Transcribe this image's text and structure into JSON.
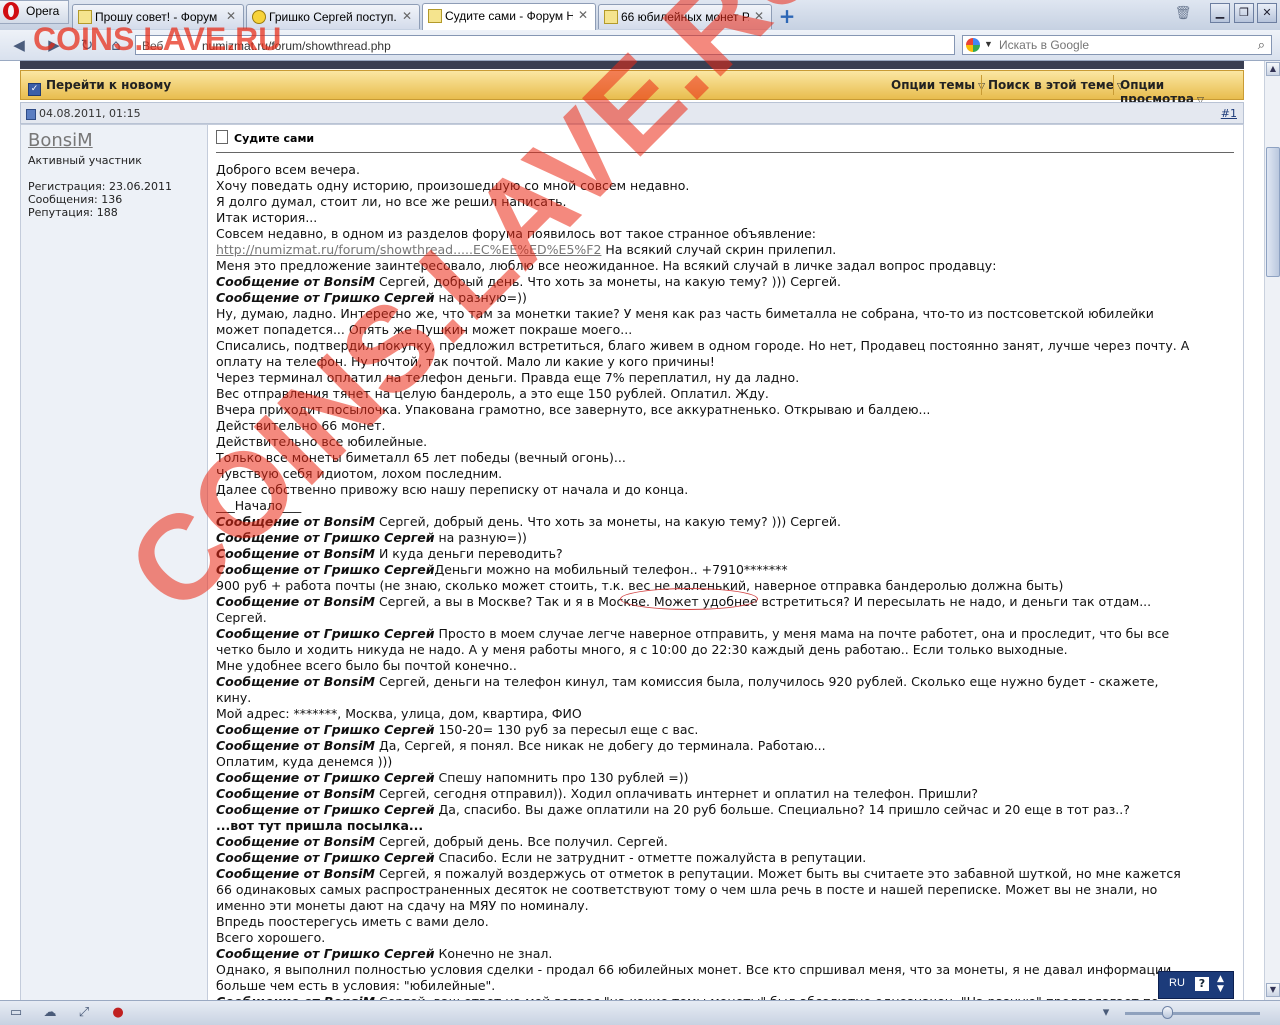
{
  "browser": {
    "app_name": "Opera",
    "tabs": [
      {
        "title": "Прошу совет! - Форум ...",
        "icon": "document-icon"
      },
      {
        "title": "Гришко Сергей поступ...",
        "icon": "smiley-icon"
      },
      {
        "title": "Судите сами - Форум Н...",
        "icon": "document-icon",
        "active": true
      },
      {
        "title": "66 юбилейных монет Р...",
        "icon": "document-icon"
      }
    ],
    "address": {
      "prefix": "Веб",
      "url": "numizmat.ru/forum/showthread.php"
    },
    "search": {
      "placeholder": "Искать в Google"
    }
  },
  "watermark": {
    "text": "COINS.LAVE.RU",
    "diagonal": "COINS.LAVE.RU"
  },
  "thread_bar": {
    "goto_new": "Перейти к новому",
    "options": [
      "Опции темы",
      "Поиск в этой теме",
      "Опции просмотра"
    ]
  },
  "post": {
    "date": "04.08.2011, 01:15",
    "number": "#1",
    "title": "Судите сами",
    "user": {
      "name": "BonsiM",
      "rank": "Активный участник",
      "registration": "Регистрация: 23.06.2011",
      "messages": "Сообщения: 136",
      "reputation": "Репутация: 188"
    },
    "lines": [
      {
        "t": "Доброго всем вечера."
      },
      {
        "t": "Хочу поведать одну историю, произошедшую со мной совсем недавно."
      },
      {
        "t": "Я долго думал, стоит ли, но все же решил написать."
      },
      {
        "t": "Итак история..."
      },
      {
        "t": "Совсем недавно, в одном из разделов форума появилось вот такое странное объявление:"
      },
      {
        "link": "http://numizmat.ru/forum/showthread.....EC%EE%ED%E5%F2",
        "t": " На всякий случай скрин прилепил."
      },
      {
        "t": "Меня это предложение заинтересовало, люблю все неожиданное. На всякий случай в личке задал вопрос продавцу:"
      },
      {
        "who": "Сообщение от BonsiM",
        "t": " Сергей, добрый день. Что хоть за монеты, на какую тему? ))) Сергей."
      },
      {
        "who": "Сообщение от Гришко Сергей",
        "t": " на разную=))"
      },
      {
        "t": "Ну, думаю, ладно. Интересно же, что там за монетки такие? У меня как раз часть биметалла не собрана, что-то из постсоветской юбилейки"
      },
      {
        "t": "может попадется... Опять же Пушкин может покраше моего..."
      },
      {
        "t": "Списались, подтвердил покупку, предложил встретиться, благо живем в одном городе. Но нет, Продавец постоянно занят, лучше через почту. А"
      },
      {
        "t": "оплату на телефон. Ну почтой, так почтой. Мало ли какие у кого причины!"
      },
      {
        "t": "Через терминал оплатил на телефон деньги. Правда еще 7% переплатил, ну да ладно."
      },
      {
        "t": "Вес отправления тянет на целую бандероль, а это еще 150 рублей. Оплатил. Жду."
      },
      {
        "t": "Вчера приходит посылочка. Упакована грамотно, все завернуто, все аккуратненько. Открываю и балдею..."
      },
      {
        "t": "Действительно 66 монет."
      },
      {
        "t": "Действительно все юбилейные."
      },
      {
        "t": "Только все монеты биметалл 65 лет победы (вечный огонь)..."
      },
      {
        "t": "Чувствую себя идиотом, лохом последним."
      },
      {
        "t": "Далее собственно привожу всю нашу переписку от начала и до конца."
      },
      {
        "t": "___Начало___"
      },
      {
        "who": "Сообщение от BonsiM",
        "t": " Сергей, добрый день. Что хоть за монеты, на какую тему? ))) Сергей."
      },
      {
        "who": "Сообщение от Гришко Сергей",
        "t": " на разную=))"
      },
      {
        "who": "Сообщение от BonsiM",
        "t": " И куда деньги переводить?"
      },
      {
        "who": "Сообщение от Гришко Сергей",
        "t": "Деньги можно на мобильный телефон.. +7910*******"
      },
      {
        "t": "900 руб + работа почты (не знаю, сколько может стоить, т.к. вес не маленький, наверное отправка бандеролью должна быть)"
      },
      {
        "who": "Сообщение от BonsiM",
        "t": " Сергей, а вы в Москве? Так и я в Москве. Может удобнее встретиться? И пересылать не надо, и деньги так отдам..."
      },
      {
        "t": "Сергей."
      },
      {
        "who": "Сообщение от Гришко Сергей",
        "t": " Просто в моем случае легче наверное отправить, у меня мама на почте работет, она и проследит, что бы все"
      },
      {
        "t": "четко было и ходить никуда не надо. А у меня работы много, я с 10:00 до 22:30 каждый день работаю.. Если только выходные."
      },
      {
        "t": "Мне удобнее всего было бы почтой конечно.."
      },
      {
        "who": "Сообщение от BonsiM",
        "t": " Сергей, деньги на телефон кинул, там комиссия была, получилось 920 рублей. Сколько еще нужно будет - скажете,"
      },
      {
        "t": "кину."
      },
      {
        "t": "Мой адрес: *******, Москва, улица, дом, квартира, ФИО"
      },
      {
        "who": "Сообщение от Гришко Сергей",
        "t": " 150-20= 130 руб за пересыл еще с вас."
      },
      {
        "who": "Сообщение от BonsiM",
        "t": " Да, Сергей, я понял. Все никак не добегу до терминала. Работаю..."
      },
      {
        "t": "Оплатим, куда денемся )))"
      },
      {
        "who": "Сообщение от Гришко Сергей",
        "t": " Спешу напомнить про 130 рублей =))"
      },
      {
        "who": "Сообщение от BonsiM",
        "t": " Сергей, сегодня отправил)). Ходил оплачивать интернет и оплатил на телефон. Пришли?"
      },
      {
        "who": "Сообщение от Гришко Сергей",
        "t": " Да, спасибо. Вы даже оплатили на 20 руб больше. Специально? 14 пришло сейчас и 20 еще в тот раз..?"
      },
      {
        "bold": "...вот тут пришла посылка..."
      },
      {
        "who": "Сообщение от BonsiM",
        "t": " Сергей, добрый день. Все получил. Сергей."
      },
      {
        "who": "Сообщение от Гришко Сергей",
        "t": " Спасибо. Если не затруднит - отметте пожалуйста в репутации."
      },
      {
        "who": "Сообщение от BonsiM",
        "t": " Сергей, я пожалуй воздержусь от отметок в репутации. Может быть вы считаете это забавной шуткой, но мне кажется"
      },
      {
        "t": "66 одинаковых самых распространенных десяток не соответствуют тому о чем шла речь в посте и нашей переписке. Может вы не знали, но"
      },
      {
        "t": "именно эти монеты дают на сдачу на МЯУ по номиналу."
      },
      {
        "t": "Впредь поостерегусь иметь с вами дело."
      },
      {
        "t": "Всего хорошего."
      },
      {
        "who": "Сообщение от Гришко Сергей",
        "t": " Конечно не знал."
      },
      {
        "t": "Однако, я выполнил полностью условия сделки - продал 66 юбилейных монет. Все кто спршивал меня, что за монеты, я не давал информации"
      },
      {
        "t": "больше чем есть в условия: \"юбилейные\"."
      },
      {
        "who": "Сообщение от BonsiM",
        "t": " Сергей, ваш ответ на мой вопрос \"на какие темы монеты\" был абсолютно однозначен. \"На разную\" предполагает по"
      }
    ]
  },
  "lang_widget": {
    "lang": "RU",
    "help": "?"
  },
  "colors": {
    "thread_bar": "#e8bd4e",
    "user_col": "#edf1f7",
    "watermark": "#e62814"
  }
}
